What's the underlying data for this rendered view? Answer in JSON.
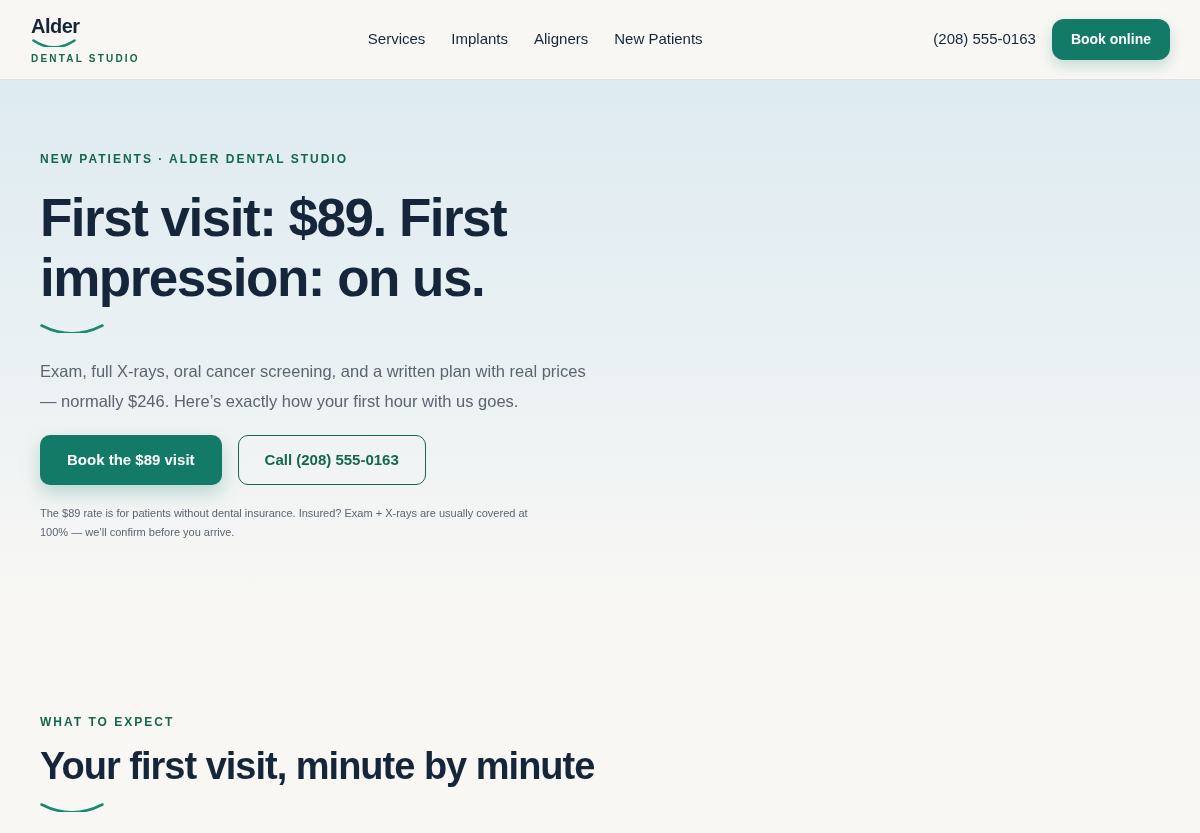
{
  "header": {
    "logo": {
      "name": "Alder",
      "tagline": "DENTAL STUDIO"
    },
    "nav": [
      "Services",
      "Implants",
      "Aligners",
      "New Patients"
    ],
    "phone": "(208) 555-0163",
    "cta": "Book online"
  },
  "hero": {
    "eyebrow": "NEW PATIENTS · ALDER DENTAL STUDIO",
    "title": "First visit: $89. First impression: on us.",
    "lead": "Exam, full X-rays, oral cancer screening, and a written plan with real prices — normally $246. Here’s exactly how your first hour with us goes.",
    "buttons": [
      {
        "label": "Book the $89 visit",
        "kind": "primary"
      },
      {
        "label": "Call (208) 555-0163",
        "kind": "outline"
      }
    ],
    "note": "The $89 rate is for patients without dental insurance. Insured? Exam + X-rays are usually covered at 100% — we’ll confirm before you arrive."
  },
  "expect": {
    "eyebrow": "WHAT TO EXPECT",
    "title": "Your first visit, minute by minute"
  }
}
